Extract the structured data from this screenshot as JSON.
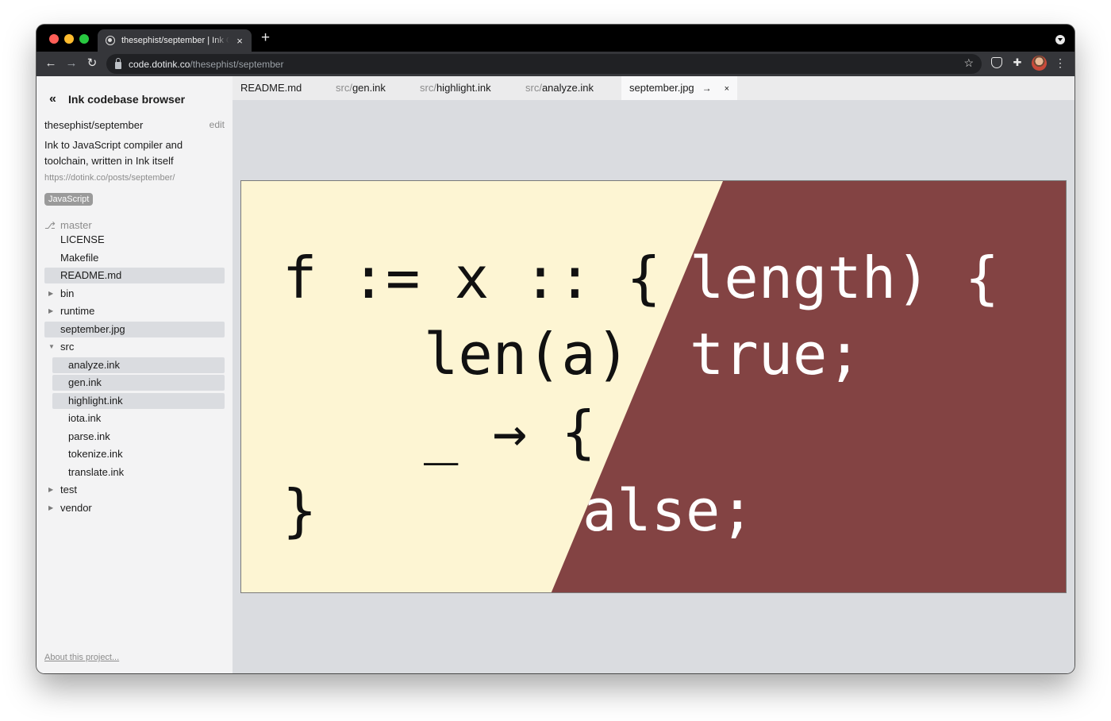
{
  "browser": {
    "tab_title": "thesephist/september | Ink Codebase Browser",
    "tab_close": "×",
    "new_tab": "+",
    "url_host": "code.dotink.co",
    "url_path": "/thesephist/september"
  },
  "icons": {
    "back": "←",
    "forward": "→",
    "reload": "↻",
    "star": "☆",
    "puzzle": "✚",
    "menu": "⋮",
    "sidebar_back": "«",
    "branch": "⎇",
    "twisty_closed": "▶",
    "twisty_open": "▼",
    "goto": "→",
    "close": "×"
  },
  "sidebar": {
    "title": "Ink codebase browser",
    "repo": "thesephist/september",
    "edit": "edit",
    "description": "Ink to JavaScript compiler and toolchain, written in Ink itself",
    "url": "https://dotink.co/posts/september/",
    "language": "JavaScript",
    "branch": "master",
    "about": "About this project...",
    "tree": [
      {
        "label": "LICENSE",
        "type": "file",
        "selected": false
      },
      {
        "label": "Makefile",
        "type": "file",
        "selected": false
      },
      {
        "label": "README.md",
        "type": "file",
        "selected": true
      },
      {
        "label": "bin",
        "type": "dir",
        "open": false
      },
      {
        "label": "runtime",
        "type": "dir",
        "open": false
      },
      {
        "label": "september.jpg",
        "type": "file",
        "selected": true
      },
      {
        "label": "src",
        "type": "dir",
        "open": true
      },
      {
        "label": "analyze.ink",
        "type": "file",
        "child": true,
        "selected": true
      },
      {
        "label": "gen.ink",
        "type": "file",
        "child": true,
        "selected": true
      },
      {
        "label": "highlight.ink",
        "type": "file",
        "child": true,
        "selected": true
      },
      {
        "label": "iota.ink",
        "type": "file",
        "child": true,
        "selected": false
      },
      {
        "label": "parse.ink",
        "type": "file",
        "child": true,
        "selected": false
      },
      {
        "label": "tokenize.ink",
        "type": "file",
        "child": true,
        "selected": false
      },
      {
        "label": "translate.ink",
        "type": "file",
        "child": true,
        "selected": false
      },
      {
        "label": "test",
        "type": "dir",
        "open": false
      },
      {
        "label": "vendor",
        "type": "dir",
        "open": false
      }
    ]
  },
  "editor_tabs": [
    {
      "dir": "",
      "name": "README.md",
      "active": false
    },
    {
      "dir": "src/",
      "name": "gen.ink",
      "active": false
    },
    {
      "dir": "src/",
      "name": "highlight.ink",
      "active": false
    },
    {
      "dir": "src/",
      "name": "analyze.ink",
      "active": false
    },
    {
      "dir": "",
      "name": "september.jpg",
      "active": true
    }
  ],
  "image": {
    "left_color": "#fdf5d3",
    "right_color": "#834343",
    "dark_text_color": "#111111",
    "light_text_color": "#ffffff",
    "left_lines": [
      "f := x :: {",
      "len(a)",
      "_ → {",
      "}"
    ],
    "right_lines": [
      "length) {",
      "true;",
      "alse;"
    ]
  }
}
